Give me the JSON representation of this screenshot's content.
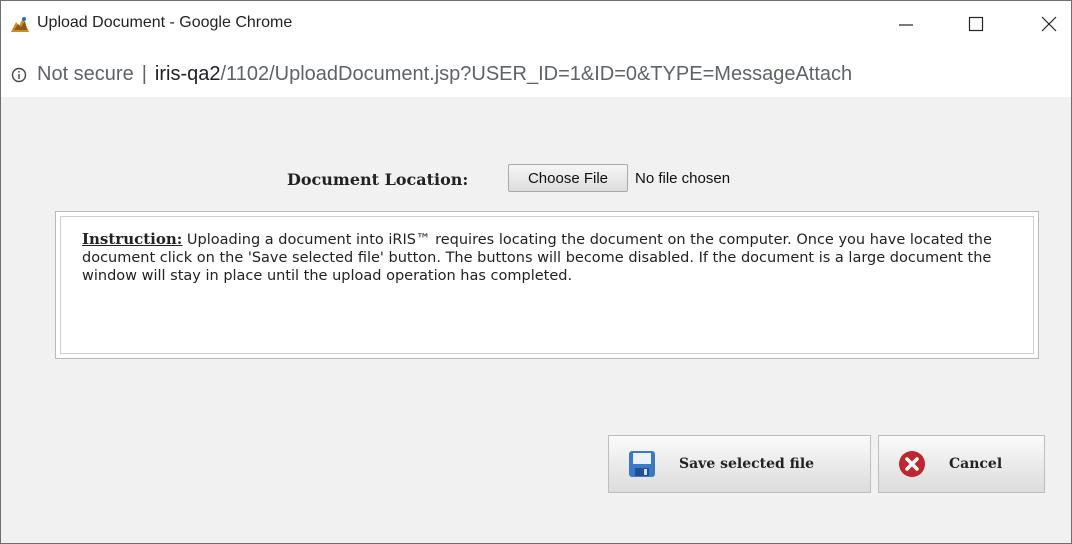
{
  "window": {
    "title": "Upload Document - Google Chrome",
    "address": {
      "security_label": "Not secure",
      "host": "iris-qa2",
      "path": "/1102/UploadDocument.jsp?USER_ID=1&ID=0&TYPE=MessageAttach"
    }
  },
  "form": {
    "document_location_label": "Document Location:",
    "choose_file_label": "Choose File",
    "no_file_text": "No file chosen"
  },
  "instruction": {
    "heading": "Instruction:",
    "body": " Uploading a document into iRIS™ requires locating the document on the computer. Once you have located the document click on the 'Save selected file' button. The buttons will become disabled. If the document is a large document the window will stay in place until the upload operation has completed."
  },
  "actions": {
    "save_label": "Save selected file",
    "cancel_label": "Cancel"
  }
}
